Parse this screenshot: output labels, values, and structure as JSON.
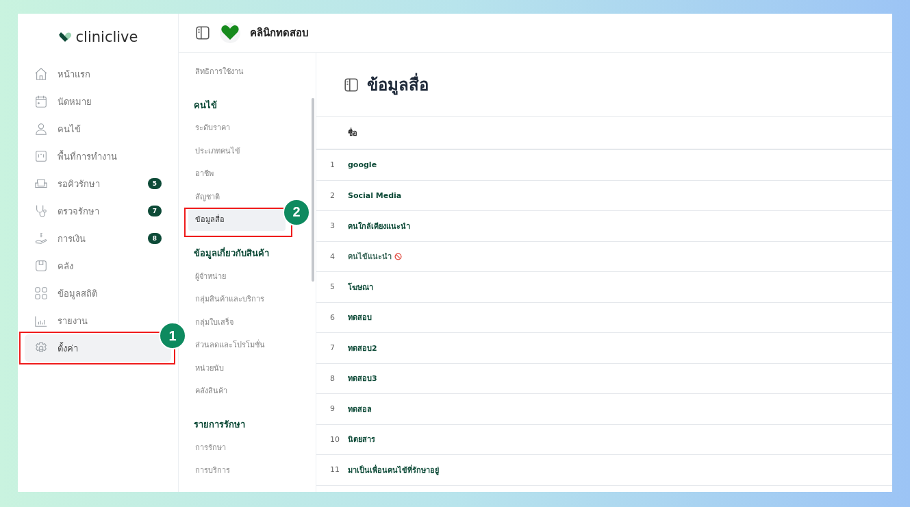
{
  "sidebar": {
    "logo": "cliniclive",
    "items": [
      {
        "label": "หน้าแรก",
        "selected": false
      },
      {
        "label": "นัดหมาย",
        "selected": false
      },
      {
        "label": "คนไข้",
        "selected": false
      },
      {
        "label": "พื้นที่การทำงาน",
        "selected": false
      },
      {
        "label": "รอคิวรักษา",
        "selected": false,
        "badge": "5"
      },
      {
        "label": "ตรวจรักษา",
        "selected": false,
        "badge": "7"
      },
      {
        "label": "การเงิน",
        "selected": false,
        "badge": "8"
      },
      {
        "label": "คลัง",
        "selected": false
      },
      {
        "label": "ข้อมูลสถิติ",
        "selected": false
      },
      {
        "label": "รายงาน",
        "selected": false
      },
      {
        "label": "ตั้งค่า",
        "selected": true,
        "callout": "1"
      }
    ]
  },
  "header": {
    "clinic_name": "คลินิกทดสอบ"
  },
  "settings_menu": {
    "sections": [
      {
        "items": [
          {
            "label": "สิทธิการใช้งาน",
            "selected": false
          }
        ]
      },
      {
        "title": "คนไข้",
        "items": [
          {
            "label": "ระดับราคา",
            "selected": false
          },
          {
            "label": "ประเภทคนไข้",
            "selected": false
          },
          {
            "label": "อาชีพ",
            "selected": false
          },
          {
            "label": "สัญชาติ",
            "selected": false
          },
          {
            "label": "ข้อมูลสื่อ",
            "selected": true,
            "callout": "2"
          }
        ]
      },
      {
        "title": "ข้อมูลเกี่ยวกับสินค้า",
        "items": [
          {
            "label": "ผู้จำหน่าย",
            "selected": false
          },
          {
            "label": "กลุ่มสินค้าและบริการ",
            "selected": false
          },
          {
            "label": "กลุ่มใบเสร็จ",
            "selected": false
          },
          {
            "label": "ส่วนลดและโปรโมชั่น",
            "selected": false
          },
          {
            "label": "หน่วยนับ",
            "selected": false
          },
          {
            "label": "คลังสินค้า",
            "selected": false
          }
        ]
      },
      {
        "title": "รายการรักษา",
        "items": [
          {
            "label": "การรักษา",
            "selected": false
          },
          {
            "label": "การบริการ",
            "selected": false
          }
        ]
      }
    ]
  },
  "page": {
    "title": "ข้อมูลสื่อ",
    "table": {
      "columns": [
        "ชื่อ"
      ],
      "rows": [
        {
          "index": "1",
          "name": "google",
          "disabled": false
        },
        {
          "index": "2",
          "name": "Social Media",
          "disabled": false
        },
        {
          "index": "3",
          "name": "คนใกล้เคียงแนะนำ",
          "disabled": false
        },
        {
          "index": "4",
          "name": "คนไข้แนะนำ",
          "disabled": true
        },
        {
          "index": "5",
          "name": "โฆษณา",
          "disabled": false
        },
        {
          "index": "6",
          "name": "ทดสอบ",
          "disabled": false
        },
        {
          "index": "7",
          "name": "ทดสอบ2",
          "disabled": false
        },
        {
          "index": "8",
          "name": "ทดสอบ3",
          "disabled": false
        },
        {
          "index": "9",
          "name": "ทดสอล",
          "disabled": false
        },
        {
          "index": "10",
          "name": "นิตยสาร",
          "disabled": false
        },
        {
          "index": "11",
          "name": "มาเป็นเพื่อนคนไข้ที่รักษาอยู่",
          "disabled": false
        }
      ]
    }
  }
}
